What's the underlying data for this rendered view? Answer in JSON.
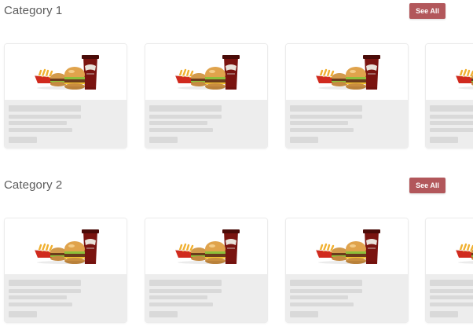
{
  "sections": [
    {
      "title": "Category 1",
      "see_all_label": "See All"
    },
    {
      "title": "Category 2",
      "see_all_label": "See All"
    }
  ],
  "card_image": {
    "icon": "burger-combo-meal",
    "alt": "Burger, fries and cola combo"
  },
  "colors": {
    "accent": "#b2575b",
    "skeleton_bg": "#ededed",
    "skeleton_bar": "#d9d9d9",
    "heading": "#5b5b5b"
  }
}
